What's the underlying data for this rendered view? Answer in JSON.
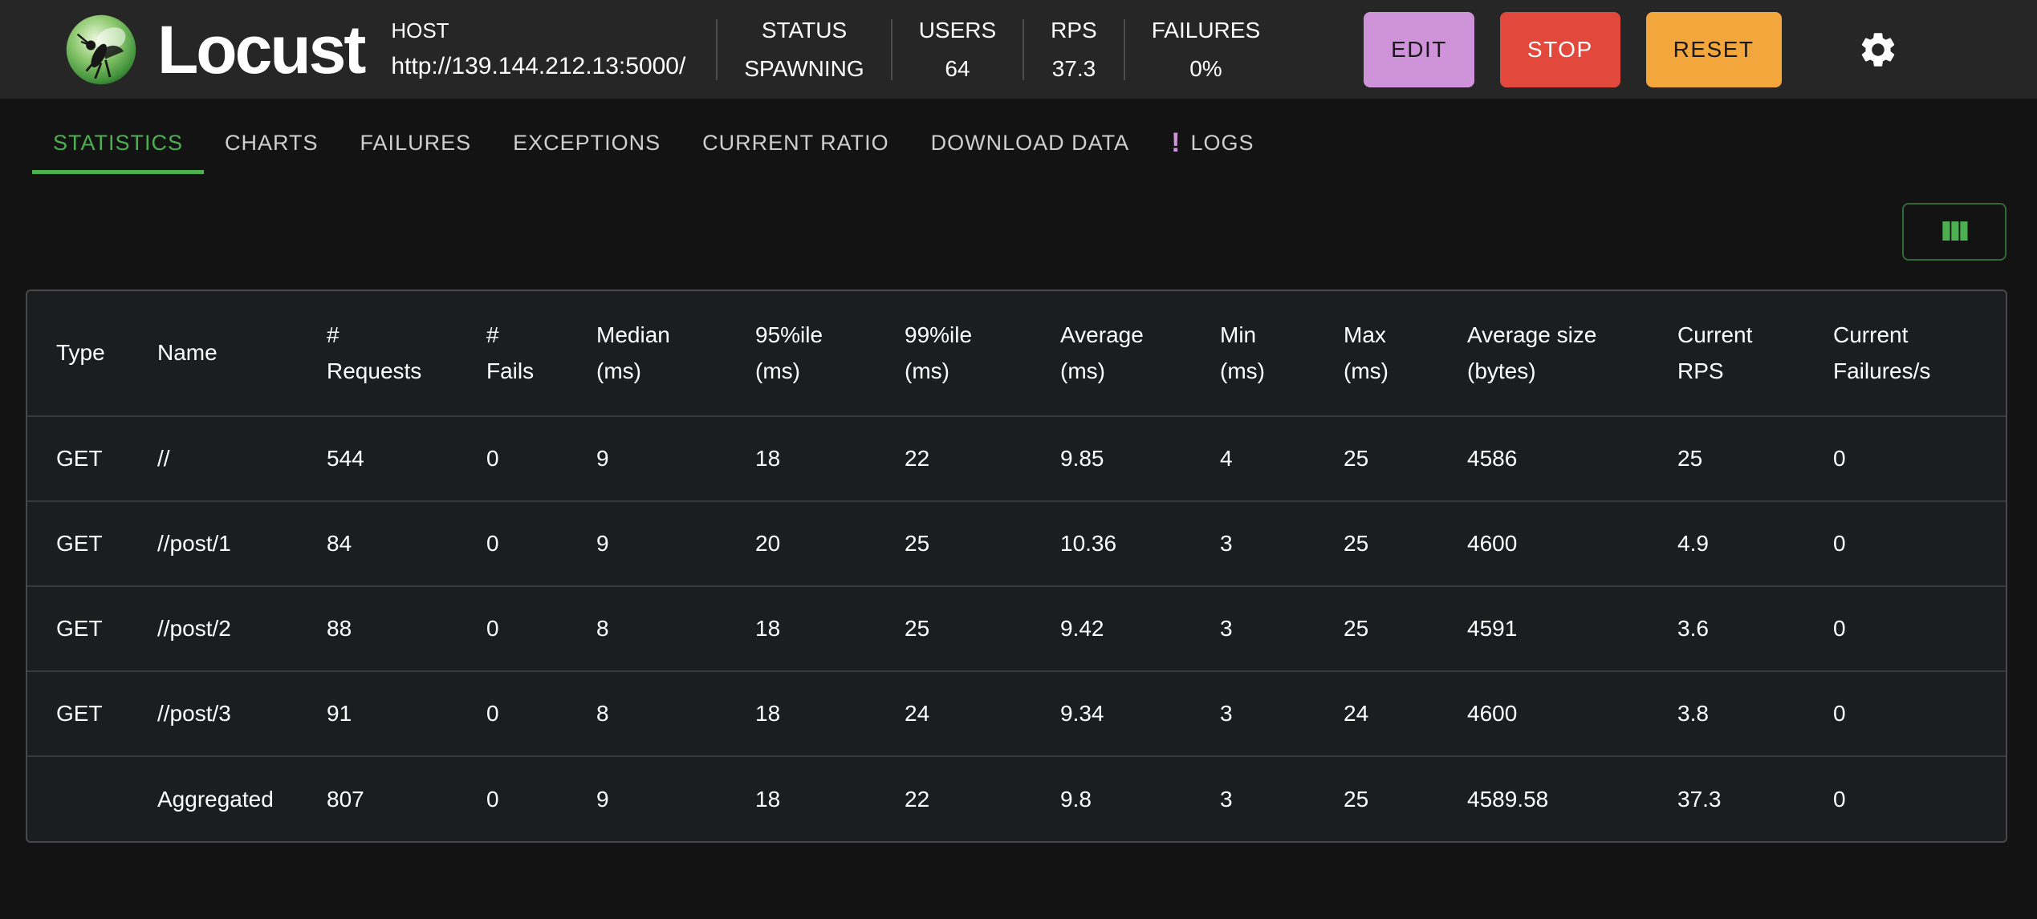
{
  "app": {
    "title": "Locust"
  },
  "header": {
    "host": {
      "label": "HOST",
      "value": "http://139.144.212.13:5000/"
    },
    "stats": [
      {
        "label": "STATUS",
        "value": "SPAWNING"
      },
      {
        "label": "USERS",
        "value": "64"
      },
      {
        "label": "RPS",
        "value": "37.3"
      },
      {
        "label": "FAILURES",
        "value": "0%"
      }
    ],
    "buttons": {
      "edit": "EDIT",
      "stop": "STOP",
      "reset": "RESET"
    },
    "icons": {
      "settings": "gear-icon",
      "logo": "locust-logo"
    }
  },
  "tabs": {
    "active": "STATISTICS",
    "logs_badge": "!",
    "items": [
      {
        "label": "STATISTICS"
      },
      {
        "label": "CHARTS"
      },
      {
        "label": "FAILURES"
      },
      {
        "label": "EXCEPTIONS"
      },
      {
        "label": "CURRENT RATIO"
      },
      {
        "label": "DOWNLOAD DATA"
      },
      {
        "label": "LOGS"
      }
    ]
  },
  "toolbar": {
    "icons": {
      "column_selector": "view-columns-icon"
    }
  },
  "colors": {
    "accent_green": "#4caf50",
    "edit_purple": "#ce93d8",
    "stop_red": "#e2493c",
    "reset_orange": "#f2a63c",
    "logs_badge_purple": "#ce93d8",
    "header_bg": "#262626",
    "page_bg": "#131314",
    "table_bg": "#1c1d1e"
  },
  "table": {
    "columns": [
      {
        "l1": "Type"
      },
      {
        "l1": "Name"
      },
      {
        "l1": "#",
        "l2": "Requests"
      },
      {
        "l1": "#",
        "l2": "Fails"
      },
      {
        "l1": "Median",
        "l2": "(ms)"
      },
      {
        "l1": "95%ile",
        "l2": "(ms)"
      },
      {
        "l1": "99%ile",
        "l2": "(ms)"
      },
      {
        "l1": "Average",
        "l2": "(ms)"
      },
      {
        "l1": "Min",
        "l2": "(ms)"
      },
      {
        "l1": "Max",
        "l2": "(ms)"
      },
      {
        "l1": "Average size",
        "l2": "(bytes)"
      },
      {
        "l1": "Current",
        "l2": "RPS"
      },
      {
        "l1": "Current",
        "l2": "Failures/s"
      }
    ],
    "rows": [
      {
        "cells": [
          "GET",
          "//",
          "544",
          "0",
          "9",
          "18",
          "22",
          "9.85",
          "4",
          "25",
          "4586",
          "25",
          "0"
        ]
      },
      {
        "cells": [
          "GET",
          "//post/1",
          "84",
          "0",
          "9",
          "20",
          "25",
          "10.36",
          "3",
          "25",
          "4600",
          "4.9",
          "0"
        ]
      },
      {
        "cells": [
          "GET",
          "//post/2",
          "88",
          "0",
          "8",
          "18",
          "25",
          "9.42",
          "3",
          "25",
          "4591",
          "3.6",
          "0"
        ]
      },
      {
        "cells": [
          "GET",
          "//post/3",
          "91",
          "0",
          "8",
          "18",
          "24",
          "9.34",
          "3",
          "24",
          "4600",
          "3.8",
          "0"
        ]
      },
      {
        "cells": [
          "",
          "Aggregated",
          "807",
          "0",
          "9",
          "18",
          "22",
          "9.8",
          "3",
          "25",
          "4589.58",
          "37.3",
          "0"
        ]
      }
    ]
  }
}
